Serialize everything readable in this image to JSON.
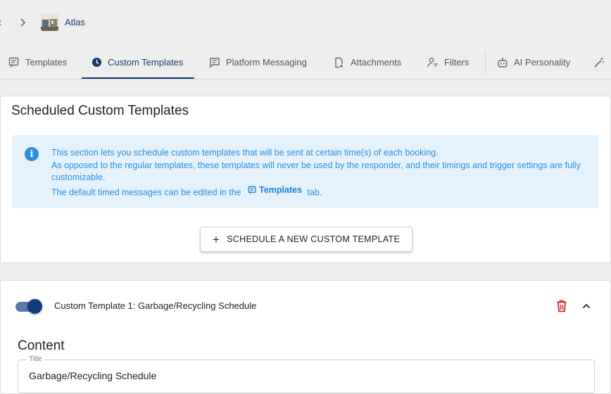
{
  "breadcrumb": {
    "previous": "t",
    "current": "Atlas"
  },
  "tabs": [
    {
      "label": "Templates",
      "icon": "chat-template-icon",
      "active": false
    },
    {
      "label": "Custom Templates",
      "icon": "clock-icon",
      "active": true
    },
    {
      "label": "Platform Messaging",
      "icon": "message-icon",
      "active": false
    },
    {
      "label": "Attachments",
      "icon": "attachment-file-icon",
      "active": false
    },
    {
      "label": "Filters",
      "icon": "person-filter-icon",
      "active": false
    },
    {
      "label": "AI Personality",
      "icon": "robot-icon",
      "active": false
    },
    {
      "label": "",
      "icon": "magic-wand-icon",
      "active": false
    }
  ],
  "scheduled": {
    "title": "Scheduled Custom Templates",
    "info_line1": "This section lets you schedule custom templates that will be sent at certain time(s) of each booking.",
    "info_line2": "As opposed to the regular templates, these templates will never be used by the responder, and their timings and trigger settings are fully customizable.",
    "info_line3_pre": "The default timed messages can be edited in the",
    "info_line3_link": "Templates",
    "info_line3_post": "tab.",
    "button_label": "SCHEDULE A NEW CUSTOM TEMPLATE"
  },
  "custom_template": {
    "enabled": true,
    "header": "Custom Template 1: Garbage/Recycling Schedule",
    "content_heading": "Content",
    "title_field_label": "Title",
    "title_field_value": "Garbage/Recycling Schedule"
  },
  "colors": {
    "primary": "#1b3a6b",
    "info_text": "#2b8fe0",
    "info_bg": "#e5f2fc",
    "delete": "#c62828",
    "toggle_thumb": "#113a78"
  }
}
